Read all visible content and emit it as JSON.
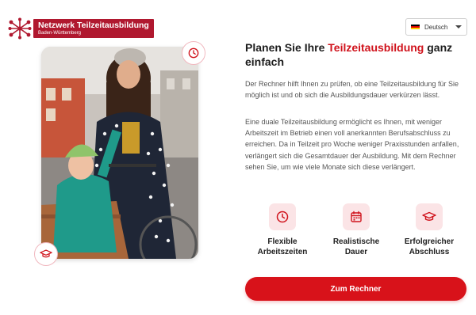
{
  "logo": {
    "title": "Netzwerk Teilzeitausbildung",
    "subtitle": "Baden-Württemberg",
    "icon": "network-logo-icon"
  },
  "language": {
    "selected": "Deutsch",
    "flag": "germany-flag-icon"
  },
  "hero": {
    "heading_prefix": "Planen Sie Ihre ",
    "heading_accent": "Teilzeitausbildung",
    "heading_suffix": " ganz einfach",
    "paragraph1": "Der Rechner hilft Ihnen zu prüfen, ob eine Teilzeitausbildung für Sie möglich ist und ob sich die Ausbildungsdauer verkürzen lässt.",
    "paragraph2": "Eine duale Teilzeitausbildung ermöglicht es Ihnen, mit weniger Arbeitszeit im Betrieb einen voll anerkannten Berufsabschluss zu erreichen. Da in Teilzeit pro Woche weniger Praxisstunden anfallen, verlängert sich die Gesamtdauer der Ausbildung. Mit dem Rechner sehen Sie, um wie viele Monate sich diese verlängert."
  },
  "features": [
    {
      "icon": "clock-icon",
      "label": "Flexible Arbeitszeiten"
    },
    {
      "icon": "calendar-icon",
      "label": "Realistische Dauer"
    },
    {
      "icon": "graduation-cap-icon",
      "label": "Erfolgreicher Abschluss"
    }
  ],
  "cta": {
    "label": "Zum Rechner"
  },
  "colors": {
    "accent": "#d8121a",
    "logo_bg": "#b0182f",
    "icon_bg": "#fbe4e6"
  }
}
